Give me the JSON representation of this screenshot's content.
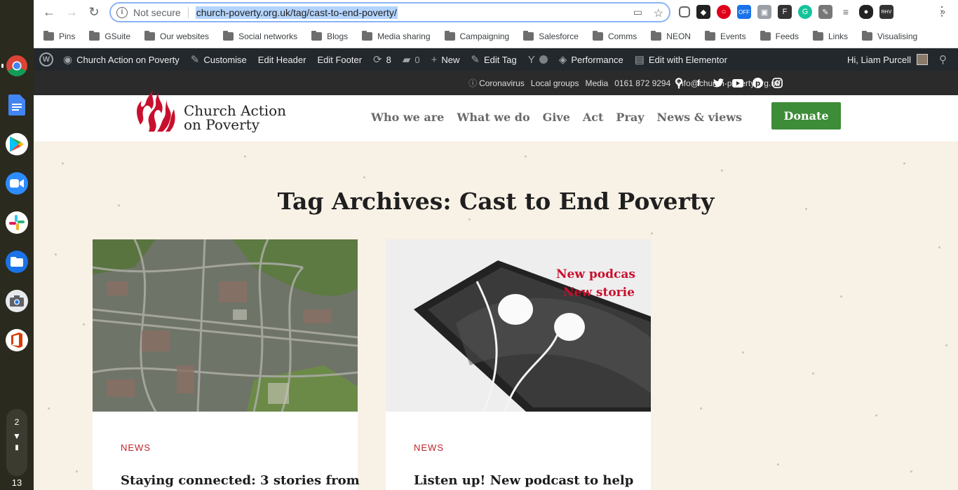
{
  "shelf": {
    "apps": [
      {
        "name": "chrome-icon",
        "color": "#db4437"
      },
      {
        "name": "docs-icon",
        "color": "#4285f4"
      },
      {
        "name": "play-store-icon",
        "color": "#34a853"
      },
      {
        "name": "zoom-icon",
        "color": "#2d8cff"
      },
      {
        "name": "slack-icon",
        "color": "#e01e5a"
      },
      {
        "name": "files-icon",
        "color": "#1a73e8"
      },
      {
        "name": "camera-icon",
        "color": "#5f6368"
      },
      {
        "name": "office-icon",
        "color": "#d83b01"
      }
    ],
    "notification_count": "2",
    "clock": "13"
  },
  "browser": {
    "not_secure": "Not secure",
    "url": "church-poverty.org.uk/tag/cast-to-end-poverty/",
    "bookmarks": [
      "Pins",
      "GSuite",
      "Our websites",
      "Social networks",
      "Blogs",
      "Media sharing",
      "Campaigning",
      "Salesforce",
      "Comms",
      "NEON",
      "Events",
      "Feeds",
      "Links",
      "Visualising"
    ]
  },
  "wp_admin": {
    "site_name": "Church Action on Poverty",
    "customise": "Customise",
    "edit_header": "Edit Header",
    "edit_footer": "Edit Footer",
    "updates": "8",
    "comments": "0",
    "new": "New",
    "edit_tag": "Edit Tag",
    "performance": "Performance",
    "edit_elementor": "Edit with Elementor",
    "greeting": "Hi, Liam Purcell"
  },
  "topbar": {
    "links": [
      "Coronavirus",
      "Local groups",
      "Media",
      "0161 872 9294",
      "info@church-poverty.org.uk"
    ]
  },
  "header": {
    "logo_line1": "Church Action",
    "logo_line2": "on Poverty",
    "nav": [
      "Who we are",
      "What we do",
      "Give",
      "Act",
      "Pray",
      "News & views"
    ],
    "donate": "Donate"
  },
  "main": {
    "title": "Tag Archives: Cast to End Poverty",
    "cards": [
      {
        "category": "NEWS",
        "title": "Staying connected: 3 stories from"
      },
      {
        "category": "NEWS",
        "title": "Listen up! New podcast to help",
        "image_line1": "New podcas",
        "image_line2": "New storie"
      }
    ]
  }
}
